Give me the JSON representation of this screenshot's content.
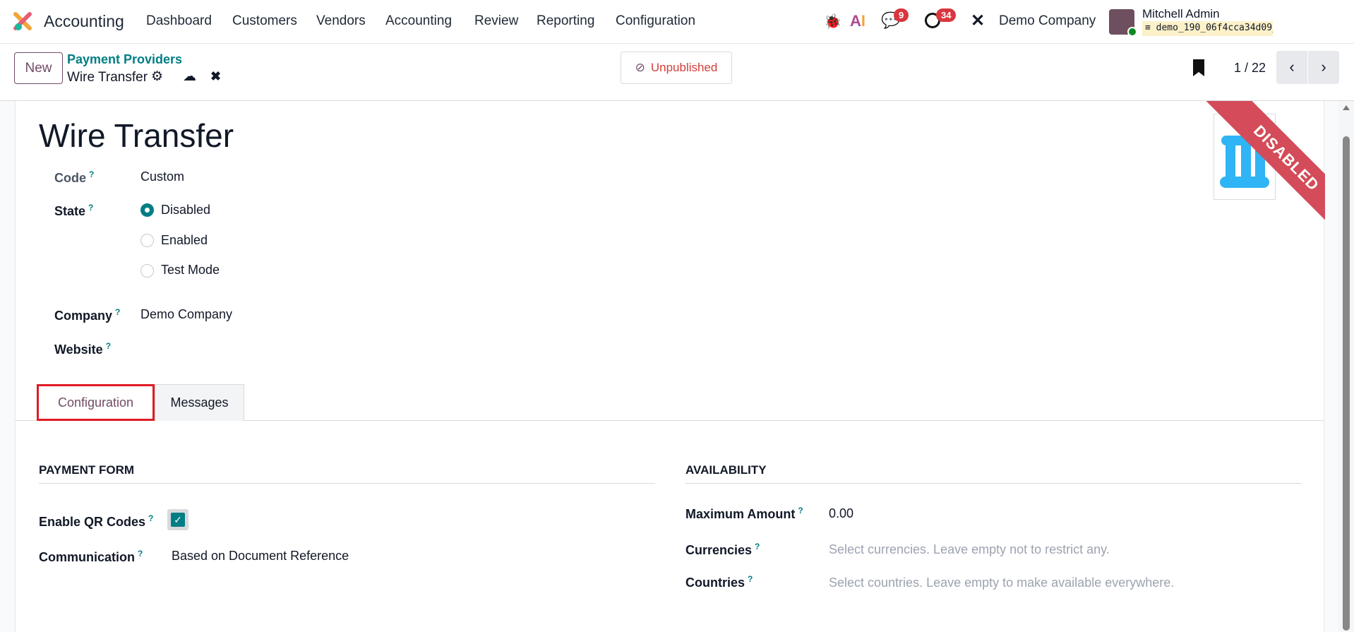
{
  "navbar": {
    "app_name": "Accounting",
    "menu": [
      "Dashboard",
      "Customers",
      "Vendors",
      "Accounting",
      "Review",
      "Reporting",
      "Configuration"
    ],
    "messages_count": "9",
    "activities_count": "34",
    "company": "Demo Company",
    "user_name": "Mitchell Admin",
    "database": "demo_190_06f4cca34d09_1764..."
  },
  "control_panel": {
    "new_label": "New",
    "breadcrumb_parent": "Payment Providers",
    "record_name": "Wire Transfer",
    "publish_status": "Unpublished",
    "pager": "1 / 22"
  },
  "form": {
    "title": "Wire Transfer",
    "ribbon": "DISABLED",
    "code_label": "Code",
    "code_value": "Custom",
    "state_label": "State",
    "state_options": [
      "Disabled",
      "Enabled",
      "Test Mode"
    ],
    "state_selected": "Disabled",
    "company_label": "Company",
    "company_value": "Demo Company",
    "website_label": "Website",
    "help": "?",
    "tabs": [
      "Configuration",
      "Messages"
    ],
    "active_tab": "Configuration",
    "payment_form": {
      "heading": "PAYMENT FORM",
      "qr_label": "Enable QR Codes",
      "qr_checked": true,
      "communication_label": "Communication",
      "communication_value": "Based on Document Reference"
    },
    "availability": {
      "heading": "AVAILABILITY",
      "max_label": "Maximum Amount",
      "max_value": "0.00",
      "currencies_label": "Currencies",
      "currencies_placeholder": "Select currencies. Leave empty not to restrict any.",
      "countries_label": "Countries",
      "countries_placeholder": "Select countries. Leave empty to make available everywhere."
    }
  },
  "colors": {
    "accent": "#017e84",
    "brand": "#714b67",
    "ribbon": "#d44c59",
    "highlight": "#e01b24"
  }
}
